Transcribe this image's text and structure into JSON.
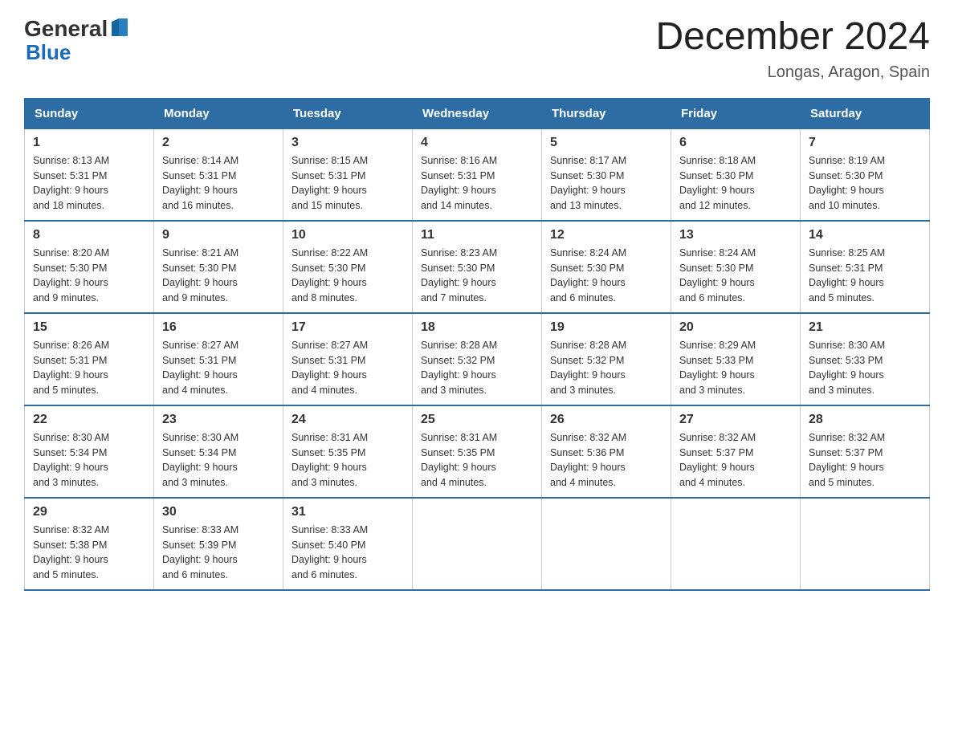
{
  "header": {
    "title": "December 2024",
    "location": "Longas, Aragon, Spain",
    "logo_general": "General",
    "logo_blue": "Blue"
  },
  "days_of_week": [
    "Sunday",
    "Monday",
    "Tuesday",
    "Wednesday",
    "Thursday",
    "Friday",
    "Saturday"
  ],
  "weeks": [
    [
      {
        "day": "1",
        "sunrise": "8:13 AM",
        "sunset": "5:31 PM",
        "daylight": "9 hours and 18 minutes."
      },
      {
        "day": "2",
        "sunrise": "8:14 AM",
        "sunset": "5:31 PM",
        "daylight": "9 hours and 16 minutes."
      },
      {
        "day": "3",
        "sunrise": "8:15 AM",
        "sunset": "5:31 PM",
        "daylight": "9 hours and 15 minutes."
      },
      {
        "day": "4",
        "sunrise": "8:16 AM",
        "sunset": "5:31 PM",
        "daylight": "9 hours and 14 minutes."
      },
      {
        "day": "5",
        "sunrise": "8:17 AM",
        "sunset": "5:30 PM",
        "daylight": "9 hours and 13 minutes."
      },
      {
        "day": "6",
        "sunrise": "8:18 AM",
        "sunset": "5:30 PM",
        "daylight": "9 hours and 12 minutes."
      },
      {
        "day": "7",
        "sunrise": "8:19 AM",
        "sunset": "5:30 PM",
        "daylight": "9 hours and 10 minutes."
      }
    ],
    [
      {
        "day": "8",
        "sunrise": "8:20 AM",
        "sunset": "5:30 PM",
        "daylight": "9 hours and 9 minutes."
      },
      {
        "day": "9",
        "sunrise": "8:21 AM",
        "sunset": "5:30 PM",
        "daylight": "9 hours and 9 minutes."
      },
      {
        "day": "10",
        "sunrise": "8:22 AM",
        "sunset": "5:30 PM",
        "daylight": "9 hours and 8 minutes."
      },
      {
        "day": "11",
        "sunrise": "8:23 AM",
        "sunset": "5:30 PM",
        "daylight": "9 hours and 7 minutes."
      },
      {
        "day": "12",
        "sunrise": "8:24 AM",
        "sunset": "5:30 PM",
        "daylight": "9 hours and 6 minutes."
      },
      {
        "day": "13",
        "sunrise": "8:24 AM",
        "sunset": "5:30 PM",
        "daylight": "9 hours and 6 minutes."
      },
      {
        "day": "14",
        "sunrise": "8:25 AM",
        "sunset": "5:31 PM",
        "daylight": "9 hours and 5 minutes."
      }
    ],
    [
      {
        "day": "15",
        "sunrise": "8:26 AM",
        "sunset": "5:31 PM",
        "daylight": "9 hours and 5 minutes."
      },
      {
        "day": "16",
        "sunrise": "8:27 AM",
        "sunset": "5:31 PM",
        "daylight": "9 hours and 4 minutes."
      },
      {
        "day": "17",
        "sunrise": "8:27 AM",
        "sunset": "5:31 PM",
        "daylight": "9 hours and 4 minutes."
      },
      {
        "day": "18",
        "sunrise": "8:28 AM",
        "sunset": "5:32 PM",
        "daylight": "9 hours and 3 minutes."
      },
      {
        "day": "19",
        "sunrise": "8:28 AM",
        "sunset": "5:32 PM",
        "daylight": "9 hours and 3 minutes."
      },
      {
        "day": "20",
        "sunrise": "8:29 AM",
        "sunset": "5:33 PM",
        "daylight": "9 hours and 3 minutes."
      },
      {
        "day": "21",
        "sunrise": "8:30 AM",
        "sunset": "5:33 PM",
        "daylight": "9 hours and 3 minutes."
      }
    ],
    [
      {
        "day": "22",
        "sunrise": "8:30 AM",
        "sunset": "5:34 PM",
        "daylight": "9 hours and 3 minutes."
      },
      {
        "day": "23",
        "sunrise": "8:30 AM",
        "sunset": "5:34 PM",
        "daylight": "9 hours and 3 minutes."
      },
      {
        "day": "24",
        "sunrise": "8:31 AM",
        "sunset": "5:35 PM",
        "daylight": "9 hours and 3 minutes."
      },
      {
        "day": "25",
        "sunrise": "8:31 AM",
        "sunset": "5:35 PM",
        "daylight": "9 hours and 4 minutes."
      },
      {
        "day": "26",
        "sunrise": "8:32 AM",
        "sunset": "5:36 PM",
        "daylight": "9 hours and 4 minutes."
      },
      {
        "day": "27",
        "sunrise": "8:32 AM",
        "sunset": "5:37 PM",
        "daylight": "9 hours and 4 minutes."
      },
      {
        "day": "28",
        "sunrise": "8:32 AM",
        "sunset": "5:37 PM",
        "daylight": "9 hours and 5 minutes."
      }
    ],
    [
      {
        "day": "29",
        "sunrise": "8:32 AM",
        "sunset": "5:38 PM",
        "daylight": "9 hours and 5 minutes."
      },
      {
        "day": "30",
        "sunrise": "8:33 AM",
        "sunset": "5:39 PM",
        "daylight": "9 hours and 6 minutes."
      },
      {
        "day": "31",
        "sunrise": "8:33 AM",
        "sunset": "5:40 PM",
        "daylight": "9 hours and 6 minutes."
      },
      null,
      null,
      null,
      null
    ]
  ]
}
